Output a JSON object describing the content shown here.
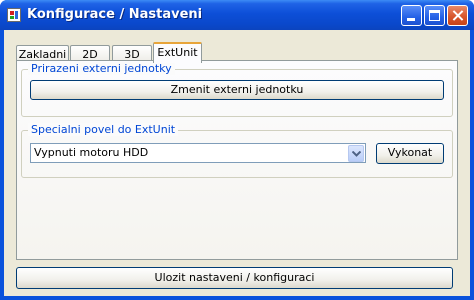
{
  "window": {
    "title": "Konfigurace / Nastaveni"
  },
  "tabs": [
    {
      "label": "Zakladni"
    },
    {
      "label": "2D"
    },
    {
      "label": "3D"
    },
    {
      "label": "ExtUnit"
    }
  ],
  "group_external": {
    "legend": "Prirazeni externi jednotky",
    "change_button": "Zmenit externi jednotku"
  },
  "group_command": {
    "legend": "Specialni povel do ExtUnit",
    "combo_value": "Vypnuti motoru HDD",
    "execute_button": "Vykonat"
  },
  "footer": {
    "save_button": "Ulozit nastaveni / konfiguraci"
  }
}
